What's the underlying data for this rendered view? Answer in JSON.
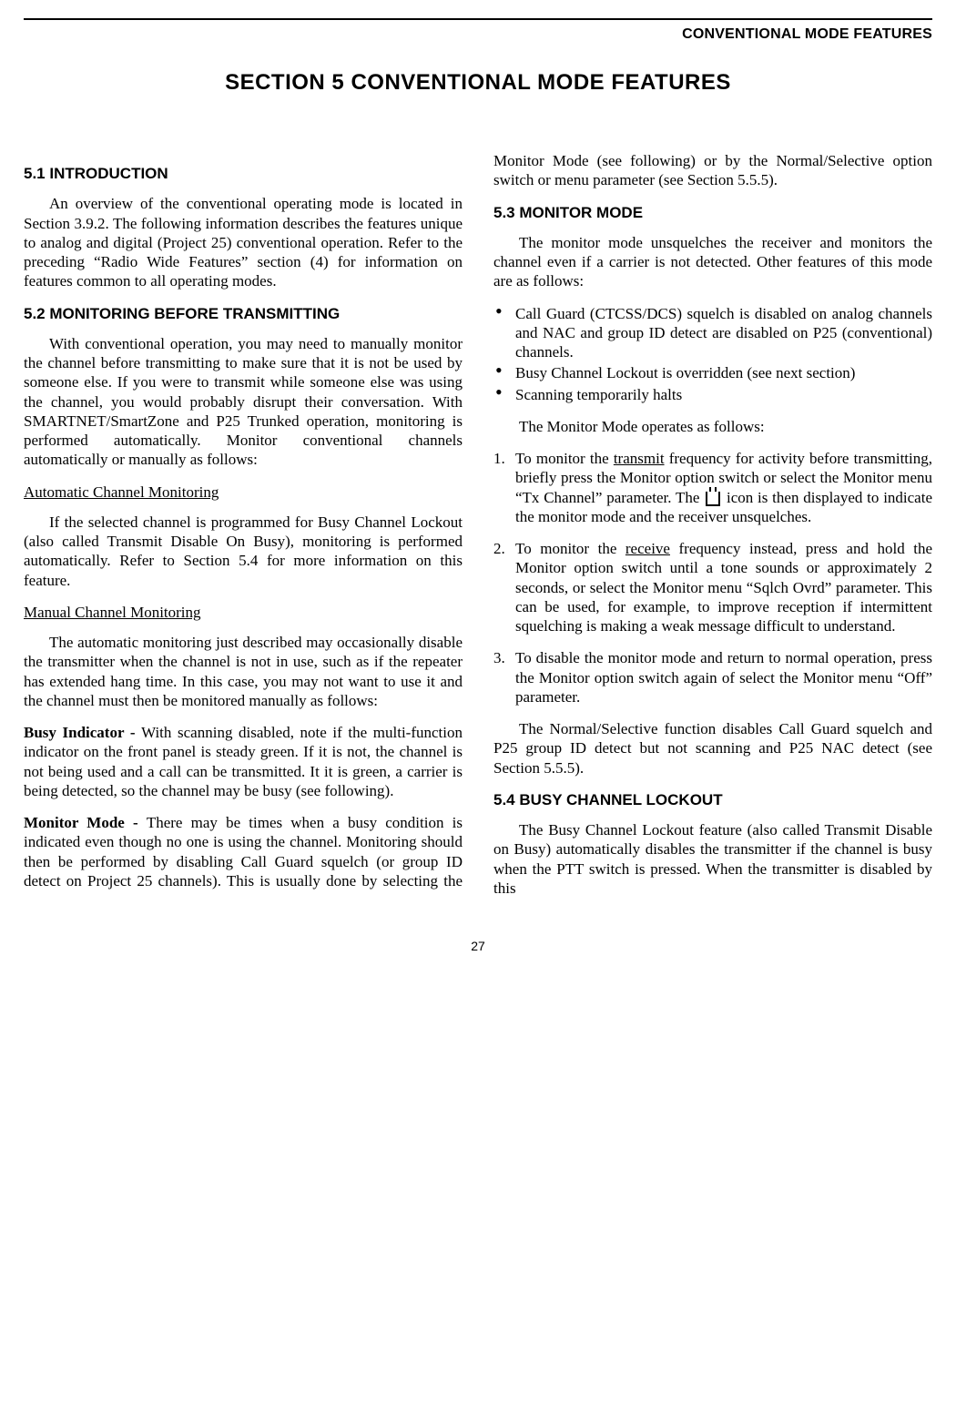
{
  "header_right": "CONVENTIONAL MODE FEATURES",
  "section_title": "SECTION 5   CONVENTIONAL MODE FEATURES",
  "page_number": "27",
  "h51": "5.1 INTRODUCTION",
  "p51": "An overview of the conventional operating mode is located in Section 3.9.2. The following information describes the features unique to analog and digital (Project 25) conventional operation. Refer to the preceding “Radio Wide Features” section (4) for information on features common to all operating modes.",
  "h52": "5.2 MONITORING BEFORE TRANSMITTING",
  "p52a": "With conventional operation, you may need to manually monitor the channel before transmitting to make sure that it is not be used by someone else. If you were to transmit while someone else was using the channel, you would probably disrupt their conversation. With SMARTNET/SmartZone and P25 Trunked operation, monitoring is performed automatically. Monitor conventional channels automatically or manually as follows:",
  "sub_auto": "Automatic Channel Monitoring",
  "p52b": "If the selected channel is programmed for Busy Channel Lockout (also called Transmit Disable On Busy), monitoring is performed automatically. Refer to Section 5.4 for more information on this feature.",
  "sub_manual": "Manual Channel Monitoring",
  "p52c": "The automatic monitoring just described may occasionally disable the transmitter when the channel is not in use, such as if the repeater has extended hang time. In this case, you may not want to use it and the channel must then be monitored manually as follows:",
  "busy_label": "Busy Indicator - ",
  "p52d": "With scanning disabled, note if the multi-function indicator on the front panel is steady green. If it is not, the channel is not being used and a call can be transmitted. It it is green, a carrier is being detected, so the channel may be busy (see following).",
  "monitor_label": "Monitor Mode - ",
  "p52e": "There may be times when a busy condition is indicated even though no one is using the channel. Monitoring should then be performed by disabling Call Guard squelch (or group ID detect on Project 25 channels). This is usually done by selecting the Monitor Mode (see following) or by the Normal/Selective option switch or menu parameter (see Section 5.5.5).",
  "h53": "5.3 MONITOR MODE",
  "p53a": "The monitor mode unsquelches the receiver and monitors the channel even if a carrier is not detected. Other features of this mode are as follows:",
  "b1": "Call Guard (CTCSS/DCS) squelch is disabled on analog channels and NAC and group ID detect are disabled on P25 (conventional) channels.",
  "b2": "Busy Channel Lockout is overridden (see next section)",
  "b3": "Scanning temporarily halts",
  "p53b": "The Monitor Mode operates as follows:",
  "s1a": "To monitor the ",
  "s1_tx": "transmit",
  "s1b": " frequency for activity before transmitting, briefly press the Monitor option switch or select the Monitor menu “Tx Channel” parameter. The ",
  "s1c": " icon is then displayed to indicate the monitor mode and the receiver unsquelches.",
  "s2a": "To monitor the ",
  "s2_rx": "receive",
  "s2b": " frequency instead, press and hold the Monitor option switch until a tone sounds or approximately 2 seconds, or select the Monitor menu “Sqlch Ovrd” parameter. This can be used, for example, to improve reception if intermittent squelching is making a weak message difficult to understand.",
  "s3": "To disable the monitor mode and return to normal operation, press the Monitor option switch again of select the Monitor menu “Off” parameter.",
  "p53c": "The Normal/Selective function disables Call Guard squelch and P25 group ID detect but not scanning and P25 NAC detect (see Section 5.5.5).",
  "h54": "5.4 BUSY CHANNEL LOCKOUT",
  "p54": "The Busy Channel Lockout feature (also called Transmit Disable on Busy) automatically disables the transmitter if the channel is busy when the PTT switch is pressed. When the transmitter is disabled by this"
}
